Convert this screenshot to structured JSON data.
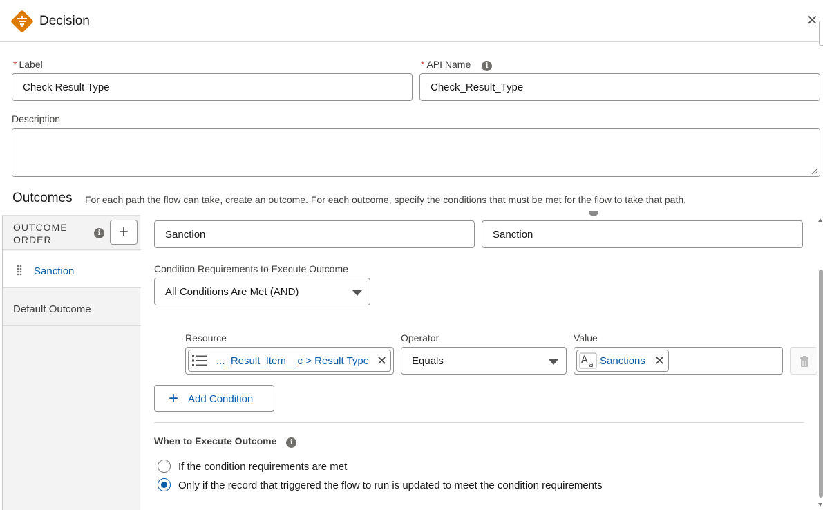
{
  "header": {
    "title": "Decision",
    "close_glyph": "✕",
    "icon": "decision-icon",
    "icon_color": "#dd7a01"
  },
  "form": {
    "required_mark": "*",
    "label": {
      "label": "Label",
      "value": "Check Result Type"
    },
    "api_name": {
      "label": "API Name",
      "value": "Check_Result_Type"
    },
    "description": {
      "label": "Description",
      "value": ""
    },
    "info_glyph": "i"
  },
  "outcomes": {
    "title": "Outcomes",
    "description": "For each path the flow can take, create an outcome. For each outcome, specify the conditions that must be met for the flow to take that path.",
    "order_label": "OUTCOME ORDER",
    "add_glyph": "+",
    "items": [
      {
        "name": "Sanction"
      },
      {
        "name": "Default Outcome"
      }
    ]
  },
  "editor": {
    "outcome_label_value": "Sanction",
    "outcome_api_value": "Sanction",
    "condition_requirements_label": "Condition Requirements to Execute Outcome",
    "condition_requirements_value": "All Conditions Are Met (AND)",
    "columns": {
      "resource": "Resource",
      "operator": "Operator",
      "value": "Value"
    },
    "condition": {
      "resource": "..._Result_Item__c > Result Type",
      "operator": "Equals",
      "value": "Sanctions"
    },
    "remove_glyph": "✕",
    "add_condition_glyph": "+",
    "add_condition_label": "Add Condition",
    "when_title": "When to Execute Outcome",
    "options": [
      {
        "label": "If the condition requirements are met",
        "selected": false
      },
      {
        "label": "Only if the record that triggered the flow to run is updated to meet the condition requirements",
        "selected": true
      }
    ]
  },
  "colors": {
    "brand_blue": "#0b5cab",
    "required_red": "#c23934",
    "decision_orange": "#dd7a01"
  }
}
